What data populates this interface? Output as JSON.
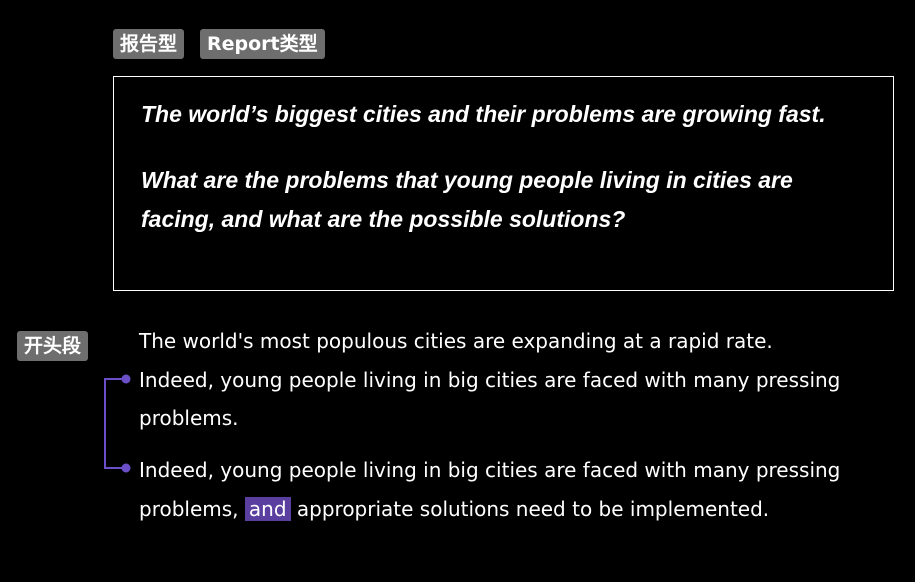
{
  "tags": {
    "type_zh": "报告型",
    "type_en": "Report类型",
    "section": "开头段"
  },
  "prompt": {
    "line1": "The world’s biggest cities and their problems are growing fast.",
    "line2": "What are the problems that young people living in cities are facing, and what are the possible solutions?"
  },
  "opening": {
    "sentence1": "The world's most populous cities are expanding at a rapid rate.",
    "sentence2": "Indeed, young people living in big cities are faced with many pressing problems.",
    "combined_before": "Indeed, young people living in big cities are faced with many pressing problems, ",
    "highlight": "and",
    "combined_after": " appropriate solutions need to be implemented."
  },
  "colors": {
    "background": "#000000",
    "tag_bg": "#6e6e6e",
    "accent": "#6a4fc9",
    "highlight_bg": "#5b3fa0"
  }
}
